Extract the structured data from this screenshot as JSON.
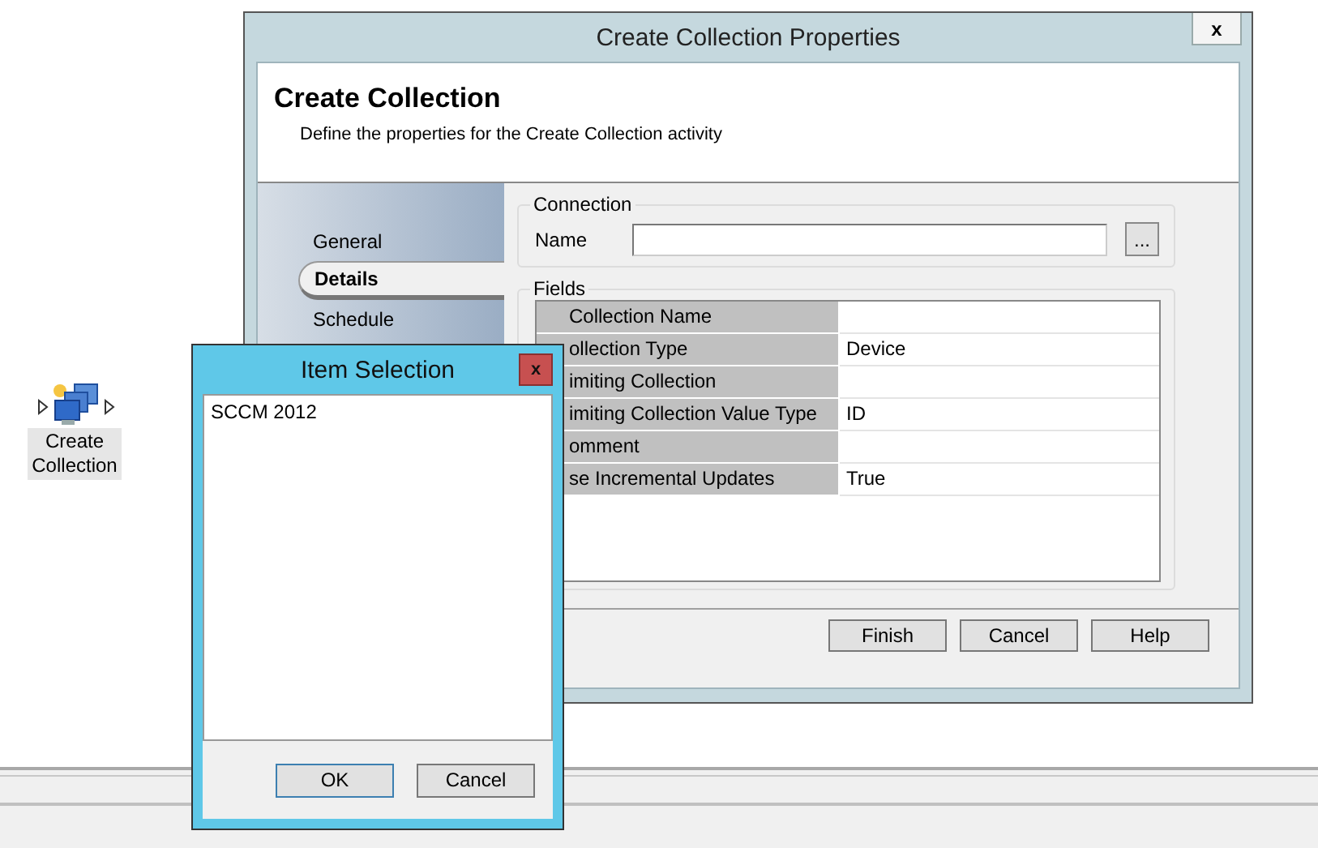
{
  "main_dialog": {
    "title": "Create Collection Properties",
    "close": "x",
    "heading": "Create Collection",
    "subheading": "Define the properties for the Create Collection activity",
    "nav": [
      {
        "label": "General",
        "selected": false
      },
      {
        "label": "Details",
        "selected": true
      },
      {
        "label": "Schedule",
        "selected": false
      }
    ],
    "connection": {
      "legend": "Connection",
      "name_label": "Name",
      "browse": "..."
    },
    "fields": {
      "legend": "Fields",
      "rows": [
        {
          "name": "Collection Name"
        },
        {
          "name": "ollection Type",
          "value": "Device"
        },
        {
          "name": "imiting Collection"
        },
        {
          "name": "imiting Collection Value Type",
          "value": "ID"
        },
        {
          "name": "omment"
        },
        {
          "name": "se Incremental Updates",
          "value": "True"
        }
      ]
    },
    "buttons": [
      "Finish",
      "Cancel",
      "Help"
    ]
  },
  "item_selection": {
    "title": "Item Selection",
    "close": "x",
    "items": [
      "SCCM 2012"
    ],
    "buttons": [
      "OK",
      "Cancel"
    ]
  },
  "canvas_activity": {
    "label": "Create Collection"
  }
}
